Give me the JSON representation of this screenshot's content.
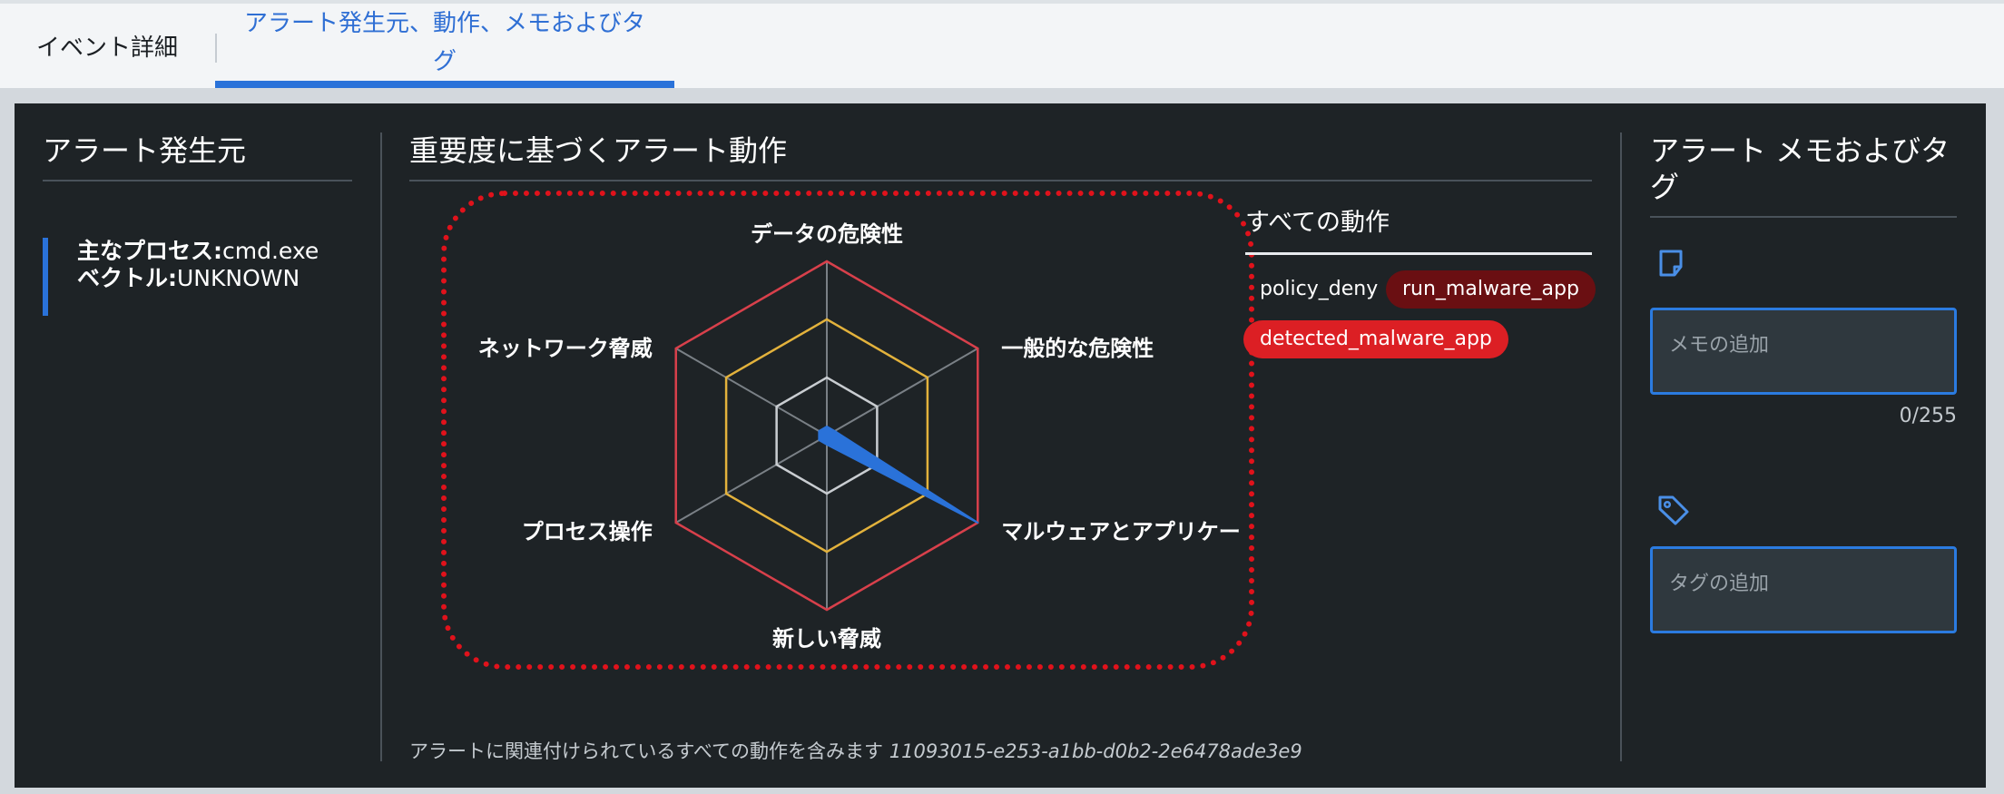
{
  "tabs": {
    "details_label": "イベント詳細",
    "active_label": "アラート発生元、動作、メモおよびタグ"
  },
  "source": {
    "title": "アラート発生元",
    "process_key": "主なプロセス:",
    "process_value": "cmd.exe",
    "vector_key": "ベクトル:",
    "vector_value": "UNKNOWN"
  },
  "severity": {
    "title": "重要度に基づくアラート動作",
    "axes": [
      "データの危険性",
      "一般的な危険性",
      "マルウェアとアプリケー",
      "新しい脅威",
      "プロセス操作",
      "ネットワーク脅威"
    ],
    "values": [
      0,
      0,
      1,
      0,
      0,
      0
    ],
    "ring_colors": [
      "#c9cdd1",
      "#e3b23c",
      "#d8404b"
    ],
    "fill_color": "#2a72d9"
  },
  "actions": {
    "title": "すべての動作",
    "items": [
      "policy_deny",
      "run_malware_app",
      "detected_malware_app"
    ]
  },
  "footer": {
    "note": "アラートに関連付けられているすべての動作を含みます",
    "id": "11093015-e253-a1bb-d0b2-2e6478ade3e9"
  },
  "memo": {
    "title": "アラート メモおよびタグ",
    "note_placeholder": "メモの追加",
    "counter": "0/255",
    "tag_placeholder": "タグの追加"
  }
}
